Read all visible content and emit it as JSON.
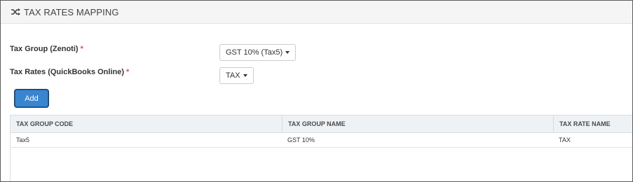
{
  "header": {
    "icon": "shuffle-icon",
    "title": "TAX RATES MAPPING"
  },
  "form": {
    "tax_group": {
      "label": "Tax Group (Zenoti)",
      "required_mark": "*",
      "selected": "GST 10% (Tax5)"
    },
    "tax_rates": {
      "label": "Tax Rates (QuickBooks Online)",
      "required_mark": "*",
      "selected": "TAX"
    },
    "add_button": "Add"
  },
  "table": {
    "columns": [
      "TAX GROUP CODE",
      "TAX GROUP NAME",
      "TAX RATE NAME"
    ],
    "rows": [
      [
        "Tax5",
        "GST 10%",
        "TAX"
      ]
    ]
  },
  "colors": {
    "accent": "#3a85d0",
    "required": "#d9534f",
    "header_bg": "#f5f5f5",
    "table_head_bg": "#eef2f5"
  }
}
